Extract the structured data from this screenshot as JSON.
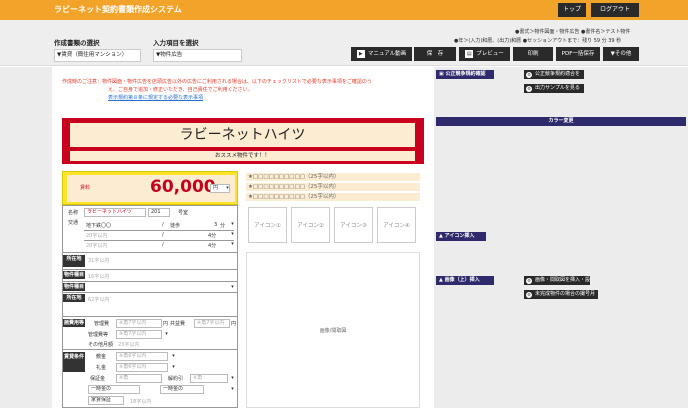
{
  "header": {
    "title": "ラビーネット契約書類作成システム",
    "top_button": "トップ",
    "logout_button": "ログアウト"
  },
  "toolbar": {
    "doc_type_label": "作成書類の選択",
    "doc_type_value": "▼賃貸（簡住用マンション）",
    "input_item_label": "入力項目を選択",
    "input_item_value": "▼物件広告",
    "info_line1": "●書式＞物件図面・物件広告 ●書件名＞テスト物件",
    "info_line2": "●年＞(入力)和暦、(出力)和暦 ●セッションアウトまで：残り 59 分 39 秒",
    "manual_button": "マニュアル動画",
    "save_button": "保　存",
    "preview_button": "プレビュー",
    "print_button": "印刷",
    "pdf_button": "PDF一括保存",
    "other_button": "▼その他"
  },
  "notice": {
    "line1": "作成時のご注意：物件図面・物件広告を店頭広告以外の広告にご利用される場合は、以下のチェックリストで必要な表示事項をご確認のう",
    "line2": "え、ご自身で追加・修正いただき、自己責任でご利用ください。",
    "link": "表示規約第８条に規定する必要な表示事項"
  },
  "property": {
    "name": "ラビーネットハイツ",
    "catch": "おススメ物件です！！",
    "rent_label": "賃料",
    "rent_value": "60,000",
    "rent_unit": "円",
    "name_label": "名称",
    "name_value": "ラビーネットハイツ",
    "room_no": "201",
    "room_suffix": "号室",
    "traffic_label": "交通",
    "line_value": "地下鉄〇〇",
    "walk_value": "徒歩",
    "walk_min": "3",
    "walk_unit": "分",
    "limit20_1": "20字以内",
    "limit20_2": "20字以内",
    "slash": "/",
    "min_unit": "4分",
    "location_label": "所在地",
    "location_ph": "31字以内",
    "type_label": "物件種目",
    "type_ph": "16字以内",
    "structure_label": "物件種目",
    "address_label": "所在地",
    "address_ph": "62字以内",
    "cost_label": "諸費用等",
    "mgmt_label": "管理費",
    "mgmt_ph": "※角7字以内",
    "mgmt_unit": "円",
    "common_label": "共益費",
    "common_ph": "※角7字以内",
    "common_unit": "円",
    "mgmt2_label": "管理費等",
    "mgmt2_ph": "※角7字以内",
    "other_label": "その他月額",
    "other_ph": "23字以内",
    "loan_label": "賃貸条件",
    "deposit_label": "敷金",
    "deposit_ph": "※角6字以内",
    "key_label": "礼金",
    "key_ph": "※角6字以内",
    "hoshou_label": "保証金",
    "hoshou_ph": "※角",
    "shokyaku_label": "解約引",
    "shokyaku_ph": "※角",
    "lumpsum1": "一時金の",
    "lumpsum2": "一時金の",
    "guarantor_label": "家賃保証",
    "guarantor_ph": "18字以内"
  },
  "features": {
    "star1": "★□□□□□□□□□□（25字以内）",
    "star2": "★□□□□□□□□□□（25字以内）",
    "star3": "★□□□□□□□□□□（25字以内）"
  },
  "icons": [
    "アイコン①",
    "アイコン②",
    "アイコン③",
    "アイコン④"
  ],
  "photo_label": "画像/間取図",
  "right_panel": {
    "section_fair": "公正競争規約確認",
    "btn_fair": "公正競争規約適合を",
    "btn_sample": "出力サンプルを見る",
    "section_color": "カラー変更",
    "section_icon": "アイコン挿入",
    "section_image": "画像（上）挿入",
    "btn_image": "画像・間取図を挿入・設",
    "btn_unfinished": "未完成物件の場合の撮号月"
  }
}
